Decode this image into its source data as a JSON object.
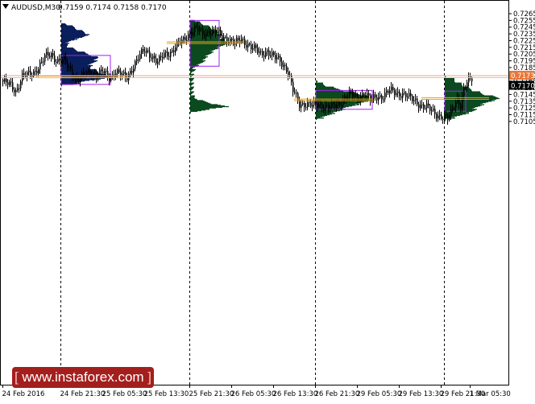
{
  "symbol_header": "AUDUSD,M30",
  "ohlc_header": "0.7159 0.7174 0.7158 0.7170",
  "watermark_text": "www.instaforex.com",
  "current_price_label": "0.7173",
  "bid_price_label": "0.7170",
  "colors": {
    "background": "#ffffff",
    "candle": "#000000",
    "vp_dark_blue": "#0b1f5c",
    "vp_dark_green": "#0b4a1e",
    "value_area_box": "#a020f0",
    "poc_line": "#e8a317",
    "current_price_line": "#f0a080",
    "current_price_tag": "#e8773a",
    "bid_price_tag": "#000000",
    "watermark_bg": "#a31f1d"
  },
  "chart_data": {
    "type": "candlestick",
    "title": "AUDUSD,M30",
    "ylim": [
      0.71,
      0.727
    ],
    "y_ticks": [
      "0.7265",
      "0.7255",
      "0.7245",
      "0.7235",
      "0.7225",
      "0.7215",
      "0.7205",
      "0.7195",
      "0.7185",
      "0.7175",
      "0.7165",
      "0.7155",
      "0.7145",
      "0.7135",
      "0.7125",
      "0.7115",
      "0.7105"
    ],
    "x_ticks": [
      "24 Feb 2016",
      "24 Feb 21:30",
      "25 Feb 05:30",
      "25 Feb 13:30",
      "25 Feb 21:30",
      "26 Feb 05:30",
      "26 Feb 13:30",
      "26 Feb 21:30",
      "29 Feb 05:30",
      "29 Feb 13:30",
      "29 Feb 21:30",
      "1 Mar 05:30"
    ],
    "session_dividers": [
      "24 Feb 21:30",
      "25 Feb 21:30",
      "26 Feb 21:30",
      "29 Feb 21:30"
    ],
    "current_price": 0.7173,
    "bid_price": 0.717,
    "close_anchors": [
      [
        0,
        0.7164
      ],
      [
        5,
        0.7158
      ],
      [
        8,
        0.715
      ],
      [
        12,
        0.7172
      ],
      [
        18,
        0.7175
      ],
      [
        22,
        0.7186
      ],
      [
        26,
        0.72
      ],
      [
        30,
        0.7204
      ],
      [
        34,
        0.7196
      ],
      [
        38,
        0.7194
      ],
      [
        42,
        0.718
      ],
      [
        46,
        0.7168
      ],
      [
        50,
        0.7172
      ],
      [
        54,
        0.7178
      ],
      [
        58,
        0.7175
      ],
      [
        62,
        0.7178
      ],
      [
        66,
        0.717
      ],
      [
        70,
        0.718
      ],
      [
        74,
        0.7172
      ],
      [
        77,
        0.717
      ],
      [
        80,
        0.7184
      ],
      [
        84,
        0.72
      ],
      [
        88,
        0.721
      ],
      [
        92,
        0.7204
      ],
      [
        96,
        0.7192
      ],
      [
        100,
        0.7204
      ],
      [
        104,
        0.7208
      ],
      [
        108,
        0.7218
      ],
      [
        112,
        0.7225
      ],
      [
        116,
        0.7238
      ],
      [
        120,
        0.7243
      ],
      [
        124,
        0.7234
      ],
      [
        128,
        0.724
      ],
      [
        132,
        0.7238
      ],
      [
        136,
        0.723
      ],
      [
        140,
        0.7228
      ],
      [
        144,
        0.722
      ],
      [
        148,
        0.7226
      ],
      [
        152,
        0.722
      ],
      [
        156,
        0.7212
      ],
      [
        160,
        0.7205
      ],
      [
        164,
        0.721
      ],
      [
        168,
        0.72
      ],
      [
        172,
        0.7195
      ],
      [
        176,
        0.7184
      ],
      [
        178,
        0.717
      ],
      [
        180,
        0.715
      ],
      [
        182,
        0.714
      ],
      [
        184,
        0.713
      ],
      [
        188,
        0.7132
      ],
      [
        192,
        0.7128
      ],
      [
        196,
        0.713
      ],
      [
        200,
        0.7128
      ],
      [
        204,
        0.7126
      ],
      [
        208,
        0.713
      ],
      [
        212,
        0.714
      ],
      [
        216,
        0.7145
      ],
      [
        220,
        0.7138
      ],
      [
        224,
        0.7148
      ],
      [
        228,
        0.7136
      ],
      [
        232,
        0.7142
      ],
      [
        236,
        0.7143
      ],
      [
        240,
        0.715
      ],
      [
        244,
        0.7148
      ],
      [
        248,
        0.7146
      ],
      [
        252,
        0.714
      ],
      [
        256,
        0.7136
      ],
      [
        260,
        0.7128
      ],
      [
        264,
        0.7124
      ],
      [
        268,
        0.7118
      ],
      [
        272,
        0.7112
      ],
      [
        276,
        0.7108
      ],
      [
        278,
        0.7118
      ],
      [
        280,
        0.7132
      ],
      [
        282,
        0.714
      ],
      [
        284,
        0.7128
      ],
      [
        286,
        0.715
      ],
      [
        288,
        0.7162
      ],
      [
        291,
        0.717
      ]
    ],
    "volume_profiles": [
      {
        "session": "24 Feb 21:30",
        "price_from": 0.7158,
        "price_to": 0.725,
        "color": "dark-blue",
        "poc": 0.7171,
        "value_area": [
          0.716,
          0.7203
        ],
        "hist": [
          [
            0.725,
            0.1
          ],
          [
            0.7245,
            0.25
          ],
          [
            0.724,
            0.4
          ],
          [
            0.7235,
            0.55
          ],
          [
            0.723,
            0.45
          ],
          [
            0.7225,
            0.2
          ],
          [
            0.722,
            0.1
          ],
          [
            0.7215,
            0.18
          ],
          [
            0.721,
            0.35
          ],
          [
            0.7205,
            0.55
          ],
          [
            0.72,
            0.75
          ],
          [
            0.7195,
            0.7
          ],
          [
            0.719,
            0.62
          ],
          [
            0.7185,
            0.58
          ],
          [
            0.718,
            0.72
          ],
          [
            0.7175,
            0.88
          ],
          [
            0.7171,
            1.0
          ],
          [
            0.7168,
            0.78
          ],
          [
            0.7165,
            0.5
          ],
          [
            0.716,
            0.25
          ]
        ]
      },
      {
        "session": "25 Feb 21:30",
        "price_from": 0.7118,
        "price_to": 0.7255,
        "color": "dark-green",
        "poc": 0.7222,
        "value_area": [
          0.7187,
          0.7255
        ],
        "hist": [
          [
            0.7255,
            0.15
          ],
          [
            0.725,
            0.3
          ],
          [
            0.7245,
            0.5
          ],
          [
            0.724,
            0.65
          ],
          [
            0.7235,
            0.75
          ],
          [
            0.723,
            0.8
          ],
          [
            0.7225,
            0.9
          ],
          [
            0.7222,
            1.0
          ],
          [
            0.7218,
            0.85
          ],
          [
            0.7214,
            0.7
          ],
          [
            0.721,
            0.6
          ],
          [
            0.7205,
            0.5
          ],
          [
            0.72,
            0.4
          ],
          [
            0.7195,
            0.35
          ],
          [
            0.719,
            0.25
          ],
          [
            0.7185,
            0.1
          ],
          [
            0.7175,
            0.06
          ],
          [
            0.7165,
            0.06
          ],
          [
            0.7155,
            0.06
          ],
          [
            0.7145,
            0.06
          ],
          [
            0.714,
            0.1
          ],
          [
            0.7135,
            0.35
          ],
          [
            0.713,
            0.65
          ],
          [
            0.7127,
            1.0
          ],
          [
            0.7124,
            0.55
          ],
          [
            0.712,
            0.2
          ]
        ]
      },
      {
        "session": "26 Feb 21:30",
        "price_from": 0.7108,
        "price_to": 0.7165,
        "color": "dark-green",
        "poc": 0.7137,
        "value_area": [
          0.7123,
          0.7151
        ],
        "hist": [
          [
            0.7165,
            0.05
          ],
          [
            0.716,
            0.12
          ],
          [
            0.7155,
            0.3
          ],
          [
            0.715,
            0.55
          ],
          [
            0.7145,
            0.8
          ],
          [
            0.714,
            0.95
          ],
          [
            0.7137,
            1.0
          ],
          [
            0.7134,
            0.85
          ],
          [
            0.713,
            0.7
          ],
          [
            0.7126,
            0.55
          ],
          [
            0.7122,
            0.45
          ],
          [
            0.7118,
            0.32
          ],
          [
            0.7114,
            0.2
          ],
          [
            0.711,
            0.1
          ]
        ]
      },
      {
        "session": "29 Feb 21:30",
        "price_from": 0.7106,
        "price_to": 0.7172,
        "color": "dark-green",
        "poc": 0.7139,
        "value_area": [
          0.712,
          0.715
        ],
        "hist": [
          [
            0.717,
            0.1
          ],
          [
            0.7165,
            0.2
          ],
          [
            0.716,
            0.3
          ],
          [
            0.7155,
            0.4
          ],
          [
            0.715,
            0.55
          ],
          [
            0.7145,
            0.7
          ],
          [
            0.7139,
            1.0
          ],
          [
            0.7135,
            0.8
          ],
          [
            0.713,
            0.65
          ],
          [
            0.7125,
            0.55
          ],
          [
            0.712,
            0.5
          ],
          [
            0.7115,
            0.3
          ],
          [
            0.711,
            0.15
          ]
        ]
      }
    ]
  }
}
